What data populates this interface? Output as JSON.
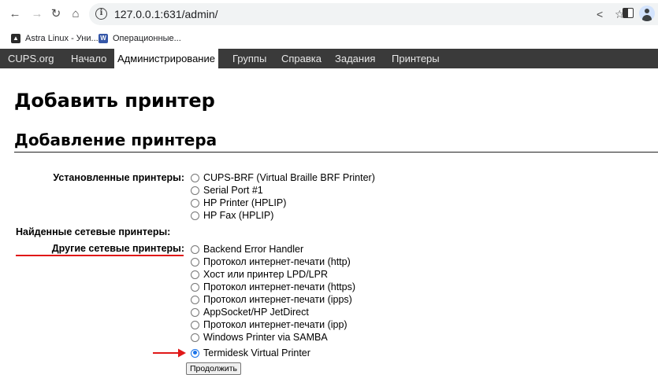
{
  "browser": {
    "url": "127.0.0.1:631/admin/",
    "bookmarks": [
      {
        "label": "Astra Linux - Уни...",
        "icon": "astra-favicon",
        "color": "#2b2b2b"
      },
      {
        "label": "Операционные...",
        "icon": "w-favicon",
        "color": "#3557a8"
      }
    ]
  },
  "nav": {
    "tabs": [
      "CUPS.org",
      "Начало",
      "Администрирование",
      "Группы",
      "Справка",
      "Задания",
      "Принтеры"
    ],
    "active_tab": "Администрирование"
  },
  "page": {
    "title": "Добавить принтер",
    "subtitle": "Добавление принтера"
  },
  "form": {
    "installed_label": "Установленные принтеры:",
    "installed": [
      "CUPS-BRF (Virtual Braille BRF Printer)",
      "Serial Port #1",
      "HP Printer (HPLIP)",
      "HP Fax (HPLIP)"
    ],
    "discovered_label": "Найденные сетевые принтеры:",
    "other_label": "Другие сетевые принтеры:",
    "other": [
      "Backend Error Handler",
      "Протокол интернет-печати (http)",
      "Хост или принтер LPD/LPR",
      "Протокол интернет-печати (https)",
      "Протокол интернет-печати (ipps)",
      "AppSocket/HP JetDirect",
      "Протокол интернет-печати (ipp)",
      "Windows Printer via SAMBA",
      "Termidesk Virtual Printer"
    ],
    "selected": "Termidesk Virtual Printer",
    "continue_label": "Продолжить"
  },
  "colors": {
    "nav_bg": "#3a3a3a",
    "annotation": "#e01818",
    "radio_checked": "#1a73e8"
  }
}
